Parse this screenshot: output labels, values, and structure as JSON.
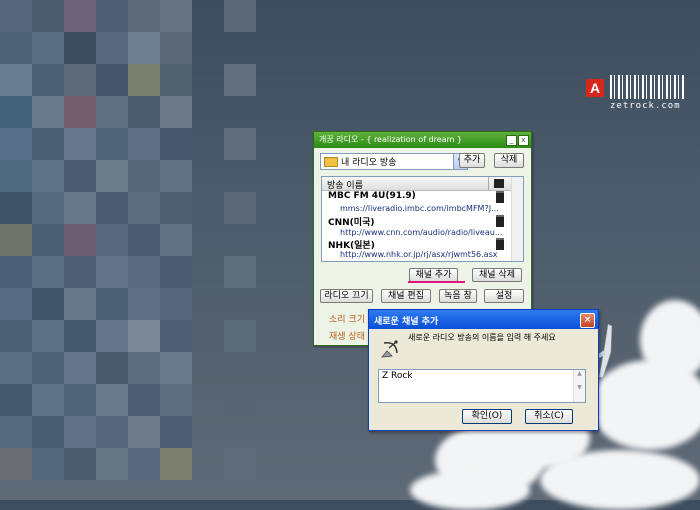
{
  "brand": {
    "logo_letter": "A",
    "text": "zetrock.com"
  },
  "radio_window": {
    "title": "개꿈 라디오 - { realization of dream }",
    "title_buttons": [
      "_",
      "x"
    ],
    "playlist_combo": {
      "value": "내 라디오 방송"
    },
    "add_label": "추가",
    "delete_label": "삭제",
    "list_header": "방송 이름",
    "stations": [
      {
        "name": "MBC FM 4U(91.9)",
        "url": "mms://liveradio.imbc.com/imbcMFM?J..."
      },
      {
        "name": "CNN(미국)",
        "url": "http://www.cnn.com/audio/radio/liveau..."
      },
      {
        "name": "NHK(일본)",
        "url": "http://www.nhk.or.jp/rj/asx/rjwmt56.asx"
      }
    ],
    "add_channel_label": "채널 추가",
    "delete_channel_label": "채널 삭제",
    "radio_off_label": "라디오 끄기",
    "edit_channel_label": "채널 편집",
    "record_label": "녹음 창",
    "settings_label": "설정",
    "volume_label": "소리 크기",
    "status_label": "재생 상태"
  },
  "dialog": {
    "title": "새로운 채널 추가",
    "close_glyph": "×",
    "prompt": "새로운 라디오 방송의 이름을 입력 해 주세요",
    "input_value": "Z Rock",
    "ok_label": "확인(O)",
    "cancel_label": "취소(C)"
  },
  "colors": {
    "accent_green": "#3a9a22",
    "xp_blue": "#0a4fd8",
    "highlight_pink": "#e3177a",
    "logo_red": "#d8261c"
  }
}
